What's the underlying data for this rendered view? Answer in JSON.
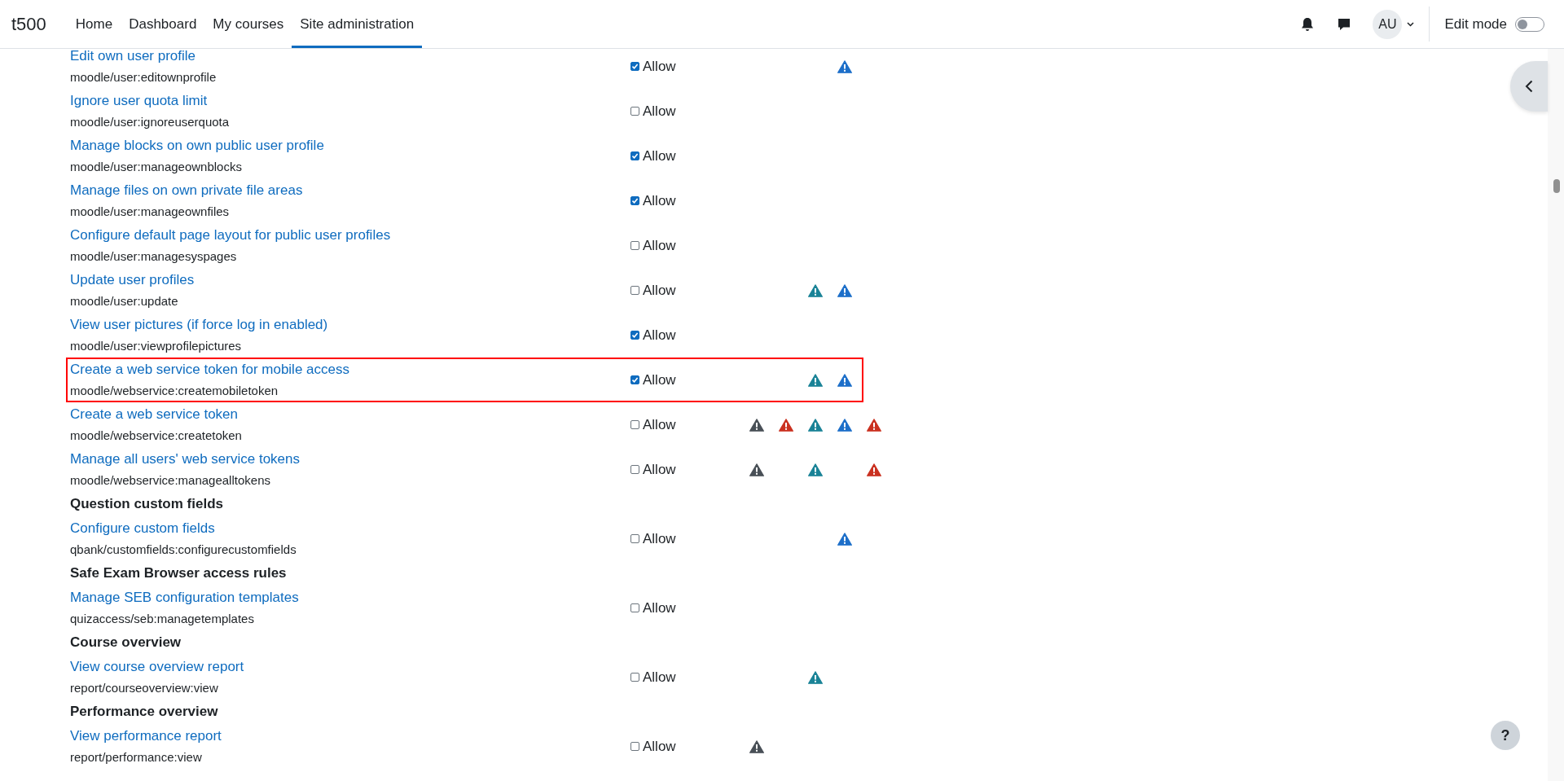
{
  "navbar": {
    "site_name": "t500",
    "links": [
      {
        "label": "Home",
        "selected": false
      },
      {
        "label": "Dashboard",
        "selected": false
      },
      {
        "label": "My courses",
        "selected": false
      },
      {
        "label": "Site administration",
        "selected": true
      }
    ],
    "avatar_initials": "AU",
    "edit_mode": {
      "label": "Edit mode",
      "on": false
    }
  },
  "items": [
    {
      "kind": "capability",
      "title": "Edit own user profile",
      "name": "moodle/user:editownprofile",
      "allow_label": "Allow",
      "checked": true,
      "highlighted": false,
      "risks": {
        "spam": true
      }
    },
    {
      "kind": "capability",
      "title": "Ignore user quota limit",
      "name": "moodle/user:ignoreuserquota",
      "allow_label": "Allow",
      "checked": false,
      "highlighted": false
    },
    {
      "kind": "capability",
      "title": "Manage blocks on own public user profile",
      "name": "moodle/user:manageownblocks",
      "allow_label": "Allow",
      "checked": true,
      "highlighted": false
    },
    {
      "kind": "capability",
      "title": "Manage files on own private file areas",
      "name": "moodle/user:manageownfiles",
      "allow_label": "Allow",
      "checked": true,
      "highlighted": false
    },
    {
      "kind": "capability",
      "title": "Configure default page layout for public user profiles",
      "name": "moodle/user:managesyspages",
      "allow_label": "Allow",
      "checked": false,
      "highlighted": false
    },
    {
      "kind": "capability",
      "title": "Update user profiles",
      "name": "moodle/user:update",
      "allow_label": "Allow",
      "checked": false,
      "highlighted": false,
      "risks": {
        "personal": true,
        "spam": true
      }
    },
    {
      "kind": "capability",
      "title": "View user pictures (if force log in enabled)",
      "name": "moodle/user:viewprofilepictures",
      "allow_label": "Allow",
      "checked": true,
      "highlighted": false
    },
    {
      "kind": "capability",
      "title": "Create a web service token for mobile access",
      "name": "moodle/webservice:createmobiletoken",
      "allow_label": "Allow",
      "checked": true,
      "highlighted": true,
      "risks": {
        "personal": true,
        "spam": true
      }
    },
    {
      "kind": "capability",
      "title": "Create a web service token",
      "name": "moodle/webservice:createtoken",
      "allow_label": "Allow",
      "checked": false,
      "highlighted": false,
      "risks": {
        "config": true,
        "xss": true,
        "personal": true,
        "spam": true,
        "dataloss": true
      }
    },
    {
      "kind": "capability",
      "title": "Manage all users' web service tokens",
      "name": "moodle/webservice:managealltokens",
      "allow_label": "Allow",
      "checked": false,
      "highlighted": false,
      "risks": {
        "config": true,
        "personal": true,
        "dataloss": true
      }
    },
    {
      "kind": "heading",
      "title": "Question custom fields"
    },
    {
      "kind": "capability",
      "title": "Configure custom fields",
      "name": "qbank/customfields:configurecustomfields",
      "allow_label": "Allow",
      "checked": false,
      "highlighted": false,
      "risks": {
        "spam": true
      }
    },
    {
      "kind": "heading",
      "title": "Safe Exam Browser access rules"
    },
    {
      "kind": "capability",
      "title": "Manage SEB configuration templates",
      "name": "quizaccess/seb:managetemplates",
      "allow_label": "Allow",
      "checked": false,
      "highlighted": false
    },
    {
      "kind": "heading",
      "title": "Course overview"
    },
    {
      "kind": "capability",
      "title": "View course overview report",
      "name": "report/courseoverview:view",
      "allow_label": "Allow",
      "checked": false,
      "highlighted": false,
      "risks": {
        "personal": true
      }
    },
    {
      "kind": "heading",
      "title": "Performance overview"
    },
    {
      "kind": "capability",
      "title": "View performance report",
      "name": "report/performance:view",
      "allow_label": "Allow",
      "checked": false,
      "highlighted": false,
      "risks": {
        "config": true
      }
    }
  ],
  "help_button": "?"
}
